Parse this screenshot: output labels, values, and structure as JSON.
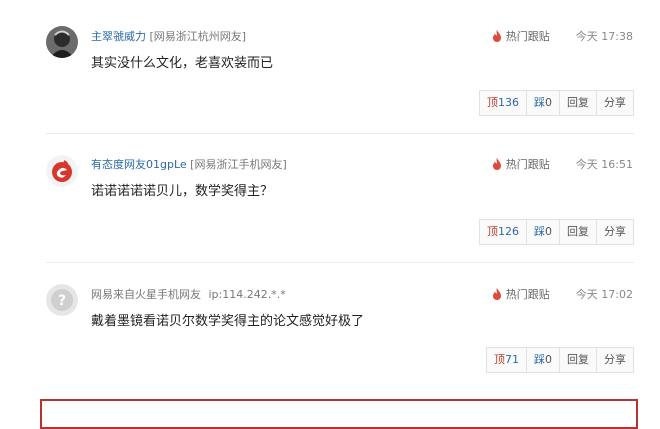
{
  "comments": [
    {
      "username": "主翠虢威力",
      "location": "[网易浙江杭州网友]",
      "hot_label": "热门跟贴",
      "time": "今天 17:38",
      "text": "其实没什么文化，老喜欢装而已",
      "avatar": "grayscale-photo-avatar",
      "actions": {
        "up_label": "顶",
        "up_count": "136",
        "down_label": "踩",
        "down_count": "0",
        "reply": "回复",
        "share": "分享"
      }
    },
    {
      "username": "有态度网友01gpLe",
      "location": "[网易浙江手机网友]",
      "hot_label": "热门跟贴",
      "time": "今天 16:51",
      "text": "诺诺诺诺诺贝儿，数学奖得主？",
      "avatar": "red-netease-logo-avatar",
      "actions": {
        "up_label": "顶",
        "up_count": "126",
        "down_label": "踩",
        "down_count": "0",
        "reply": "回复",
        "share": "分享"
      }
    },
    {
      "username": "网易来自火星手机网友",
      "location": "ip:114.242.*.*",
      "hot_label": "热门跟贴",
      "time": "今天 17:02",
      "text": "戴着墨镜看诺贝尔数学奖得主的论文感觉好极了",
      "avatar": "question-mark-avatar",
      "actions": {
        "up_label": "顶",
        "up_count": "71",
        "down_label": "踩",
        "down_count": "0",
        "reply": "回复",
        "share": "分享"
      }
    }
  ],
  "colors": {
    "username": "#2b6aa8",
    "flame": "#e04a3a",
    "up": "#c0392b",
    "bottom_border": "#b73232"
  },
  "icons": {
    "hot": "flame-icon"
  }
}
